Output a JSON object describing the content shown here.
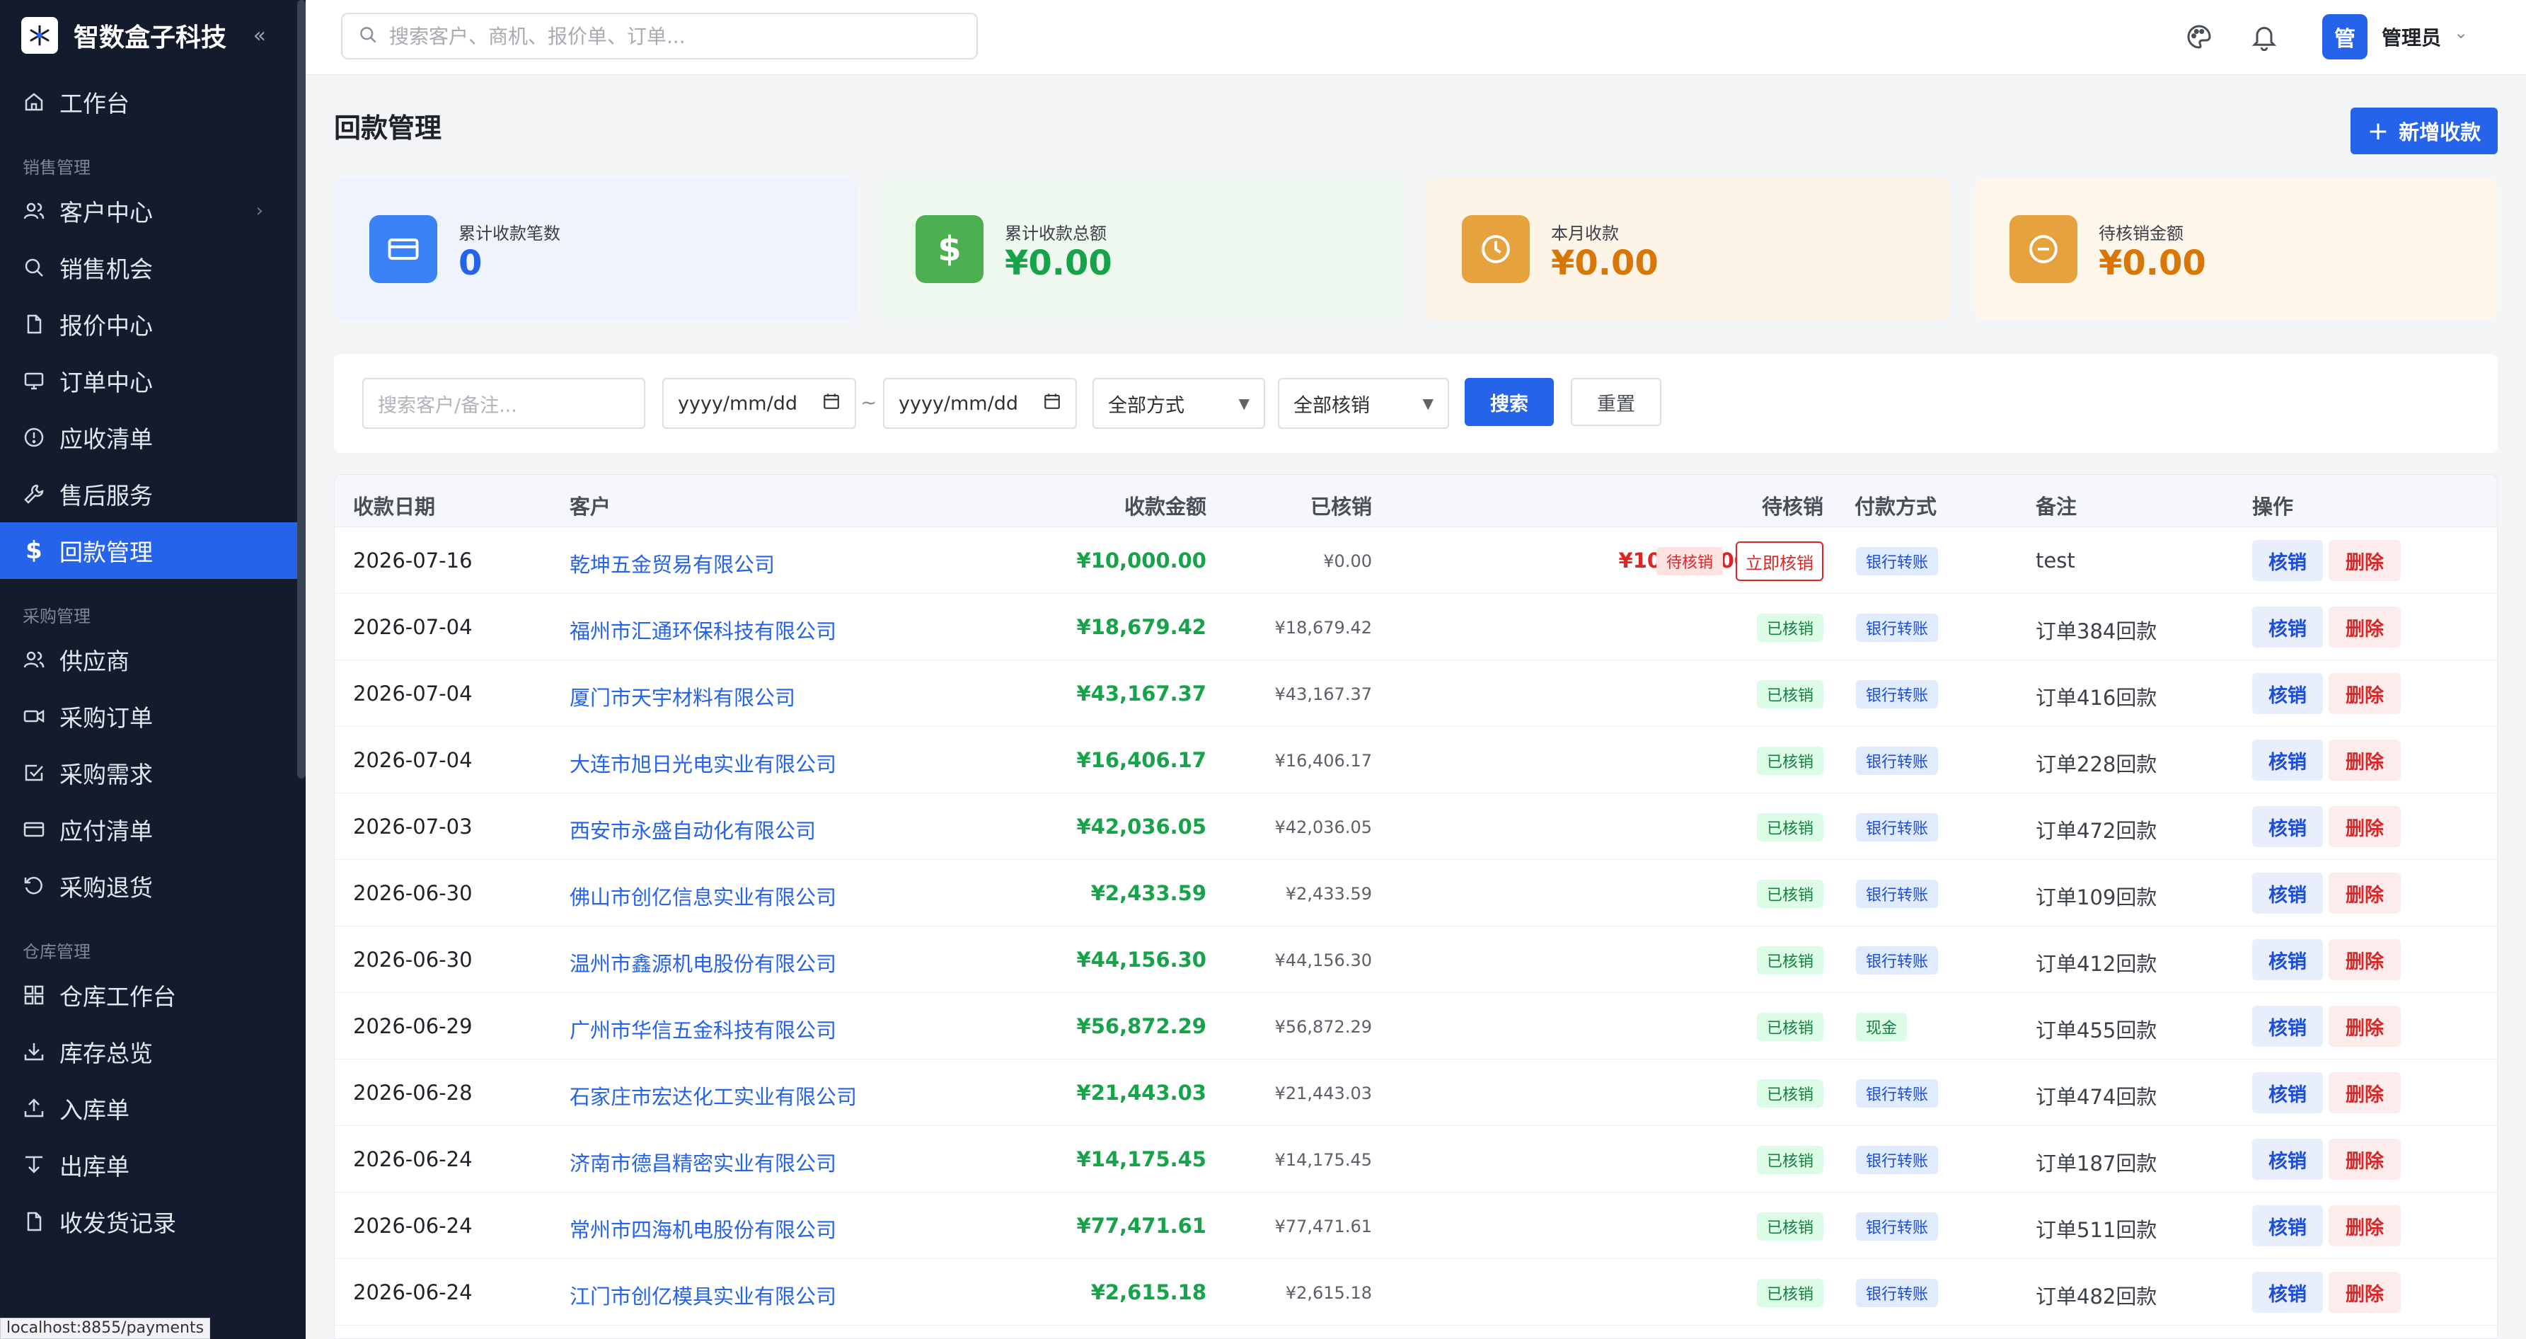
{
  "sidebar": {
    "brand": "智数盒子科技",
    "collapse": "«",
    "top_item": "工作台",
    "sales_section": "销售管理",
    "sales_items": [
      "客户中心",
      "销售机会",
      "报价中心",
      "订单中心",
      "应收清单",
      "售后服务",
      "回款管理"
    ],
    "purchase_section": "采购管理",
    "purchase_items": [
      "供应商",
      "采购订单",
      "采购需求",
      "应付清单",
      "采购退货"
    ],
    "warehouse_section": "仓库管理",
    "warehouse_items": [
      "仓库工作台",
      "库存总览",
      "入库单",
      "出库单",
      "收发货记录"
    ],
    "active": "回款管理"
  },
  "status_url": "localhost:8855/payments",
  "header": {
    "search_placeholder": "搜索客户、商机、报价单、订单...",
    "avatar_char": "管",
    "user_name": "管理员"
  },
  "page": {
    "title": "回款管理",
    "add_button": "新增收款"
  },
  "stats": [
    {
      "label": "累计收款笔数",
      "value": "0",
      "color": "#2563eb",
      "bg": "#eef3fd",
      "icon_bg": "#3b82f6"
    },
    {
      "label": "累计收款总额",
      "value": "¥0.00",
      "color": "#16a34a",
      "bg": "#eef8ee",
      "icon_bg": "#4caf50"
    },
    {
      "label": "本月收款",
      "value": "¥0.00",
      "color": "#d97706",
      "bg": "#fdf4e7",
      "icon_bg": "#e6a23c"
    },
    {
      "label": "待核销金额",
      "value": "¥0.00",
      "color": "#d97706",
      "bg": "#fdf6ea",
      "icon_bg": "#e6a23c"
    }
  ],
  "filters": {
    "search_placeholder": "搜索客户/备注...",
    "date_from": "yyyy/mm/dd",
    "date_sep": "~",
    "date_to": "yyyy/mm/dd",
    "method": "全部方式",
    "verify": "全部核销",
    "search_btn": "搜索",
    "reset_btn": "重置"
  },
  "table": {
    "columns": [
      "收款日期",
      "客户",
      "收款金额",
      "已核销",
      "待核销",
      "付款方式",
      "备注",
      "操作"
    ],
    "verify_btn": "核销",
    "delete_btn": "删除",
    "pending_tag": "待核销",
    "verify_now": "立即核销",
    "done_tag": "已核销",
    "rows": [
      {
        "date": "2026-07-16",
        "customer": "乾坤五金贸易有限公司",
        "amount": "¥10,000.00",
        "paid": "¥0.00",
        "pending": "¥10,000.00",
        "method": "银行转账",
        "note": "test",
        "status": "pending"
      },
      {
        "date": "2026-07-04",
        "customer": "福州市汇通环保科技有限公司",
        "amount": "¥18,679.42",
        "paid": "¥18,679.42",
        "method": "银行转账",
        "note": "订单384回款",
        "status": "done"
      },
      {
        "date": "2026-07-04",
        "customer": "厦门市天宇材料有限公司",
        "amount": "¥43,167.37",
        "paid": "¥43,167.37",
        "method": "银行转账",
        "note": "订单416回款",
        "status": "done"
      },
      {
        "date": "2026-07-04",
        "customer": "大连市旭日光电实业有限公司",
        "amount": "¥16,406.17",
        "paid": "¥16,406.17",
        "method": "银行转账",
        "note": "订单228回款",
        "status": "done"
      },
      {
        "date": "2026-07-03",
        "customer": "西安市永盛自动化有限公司",
        "amount": "¥42,036.05",
        "paid": "¥42,036.05",
        "method": "银行转账",
        "note": "订单472回款",
        "status": "done"
      },
      {
        "date": "2026-06-30",
        "customer": "佛山市创亿信息实业有限公司",
        "amount": "¥2,433.59",
        "paid": "¥2,433.59",
        "method": "银行转账",
        "note": "订单109回款",
        "status": "done"
      },
      {
        "date": "2026-06-30",
        "customer": "温州市鑫源机电股份有限公司",
        "amount": "¥44,156.30",
        "paid": "¥44,156.30",
        "method": "银行转账",
        "note": "订单412回款",
        "status": "done"
      },
      {
        "date": "2026-06-29",
        "customer": "广州市华信五金科技有限公司",
        "amount": "¥56,872.29",
        "paid": "¥56,872.29",
        "method": "现金",
        "note": "订单455回款",
        "status": "done"
      },
      {
        "date": "2026-06-28",
        "customer": "石家庄市宏达化工实业有限公司",
        "amount": "¥21,443.03",
        "paid": "¥21,443.03",
        "method": "银行转账",
        "note": "订单474回款",
        "status": "done"
      },
      {
        "date": "2026-06-24",
        "customer": "济南市德昌精密实业有限公司",
        "amount": "¥14,175.45",
        "paid": "¥14,175.45",
        "method": "银行转账",
        "note": "订单187回款",
        "status": "done"
      },
      {
        "date": "2026-06-24",
        "customer": "常州市四海机电股份有限公司",
        "amount": "¥77,471.61",
        "paid": "¥77,471.61",
        "method": "银行转账",
        "note": "订单511回款",
        "status": "done"
      },
      {
        "date": "2026-06-24",
        "customer": "江门市创亿模具实业有限公司",
        "amount": "¥2,615.18",
        "paid": "¥2,615.18",
        "method": "银行转账",
        "note": "订单482回款",
        "status": "done"
      }
    ]
  }
}
